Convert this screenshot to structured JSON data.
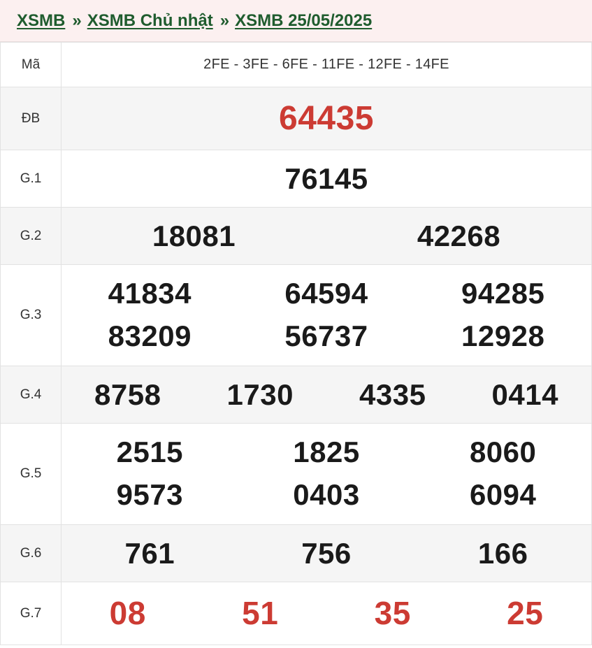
{
  "breadcrumb": {
    "item1": "XSMB",
    "item2": "XSMB Chủ nhật",
    "item3": "XSMB 25/05/2025",
    "separator": "»"
  },
  "table": {
    "code": {
      "label": "Mã",
      "value": "2FE - 3FE - 6FE - 11FE - 12FE - 14FE"
    },
    "db": {
      "label": "ĐB",
      "numbers": [
        "64435"
      ]
    },
    "g1": {
      "label": "G.1",
      "numbers": [
        "76145"
      ]
    },
    "g2": {
      "label": "G.2",
      "numbers": [
        "18081",
        "42268"
      ]
    },
    "g3": {
      "label": "G.3",
      "numbers": [
        "41834",
        "64594",
        "94285",
        "83209",
        "56737",
        "12928"
      ]
    },
    "g4": {
      "label": "G.4",
      "numbers": [
        "8758",
        "1730",
        "4335",
        "0414"
      ]
    },
    "g5": {
      "label": "G.5",
      "numbers": [
        "2515",
        "1825",
        "8060",
        "9573",
        "0403",
        "6094"
      ]
    },
    "g6": {
      "label": "G.6",
      "numbers": [
        "761",
        "756",
        "166"
      ]
    },
    "g7": {
      "label": "G.7",
      "numbers": [
        "08",
        "51",
        "35",
        "25"
      ]
    }
  },
  "colors": {
    "breadcrumb_bg": "#fcf0f0",
    "breadcrumb_link": "#1f5c2e",
    "highlight_red": "#cc3b33",
    "number_dark": "#1a1a1a"
  }
}
